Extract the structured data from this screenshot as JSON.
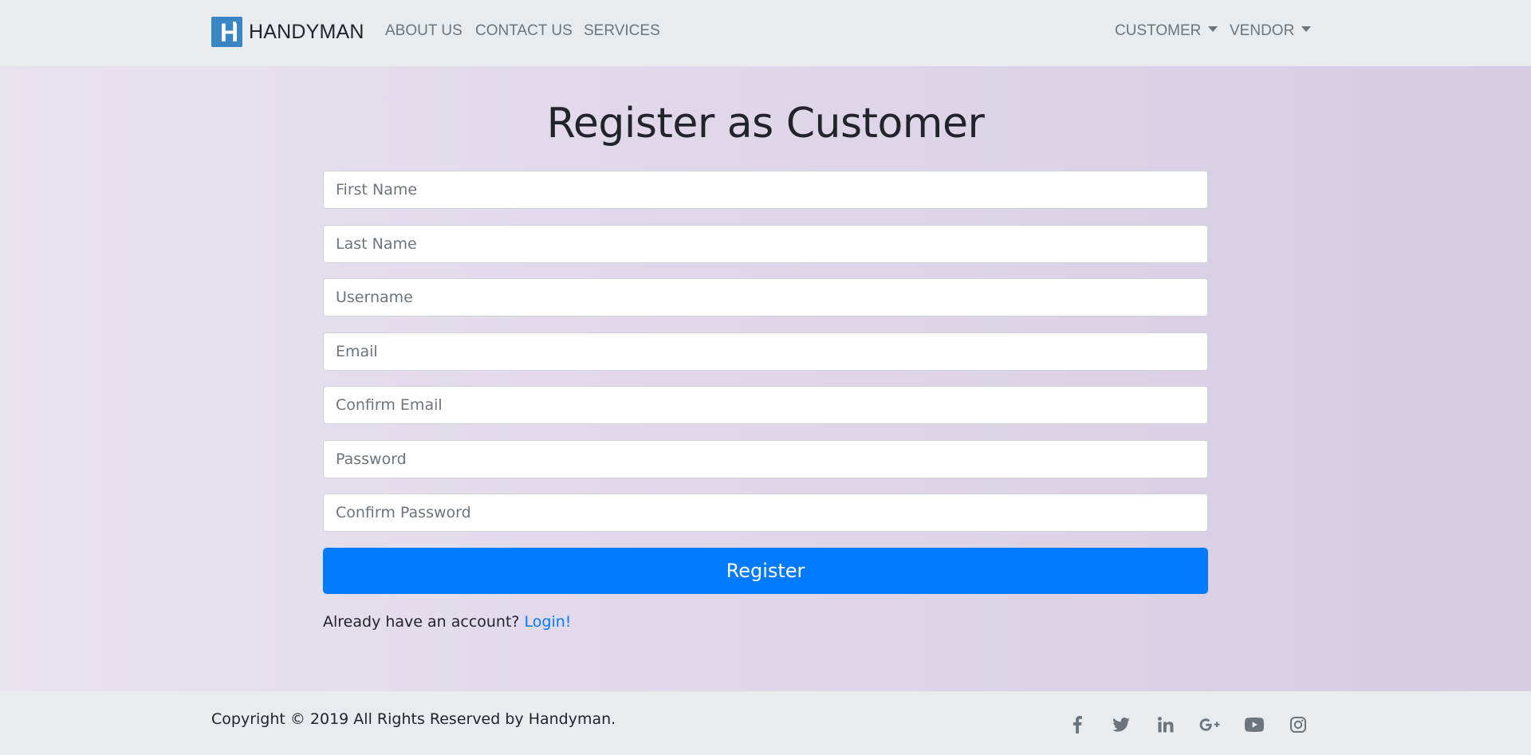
{
  "navbar": {
    "brand": {
      "logo_letter": "H",
      "name": "HANDYMAN"
    },
    "links": [
      {
        "label": "ABOUT US"
      },
      {
        "label": "CONTACT US"
      },
      {
        "label": "SERVICES"
      }
    ],
    "dropdowns": [
      {
        "label": "CUSTOMER"
      },
      {
        "label": "VENDOR"
      }
    ]
  },
  "form": {
    "title": "Register as Customer",
    "fields": [
      {
        "placeholder": "First Name",
        "value": ""
      },
      {
        "placeholder": "Last Name",
        "value": ""
      },
      {
        "placeholder": "Username",
        "value": ""
      },
      {
        "placeholder": "Email",
        "value": ""
      },
      {
        "placeholder": "Confirm Email",
        "value": ""
      },
      {
        "placeholder": "Password",
        "value": ""
      },
      {
        "placeholder": "Confirm Password",
        "value": ""
      }
    ],
    "submit_label": "Register",
    "login_prompt": "Already have an account?",
    "login_link": "Login!"
  },
  "footer": {
    "copyright": "Copyright © 2019 All Rights Reserved by Handyman.",
    "social_icons": [
      "facebook-icon",
      "twitter-icon",
      "linkedin-icon",
      "google-plus-icon",
      "youtube-icon",
      "instagram-icon"
    ]
  },
  "colors": {
    "primary": "#007bff",
    "navbar_bg": "#e9ecef",
    "logo_bg": "#3a85c4",
    "muted_text": "#6c757d"
  }
}
